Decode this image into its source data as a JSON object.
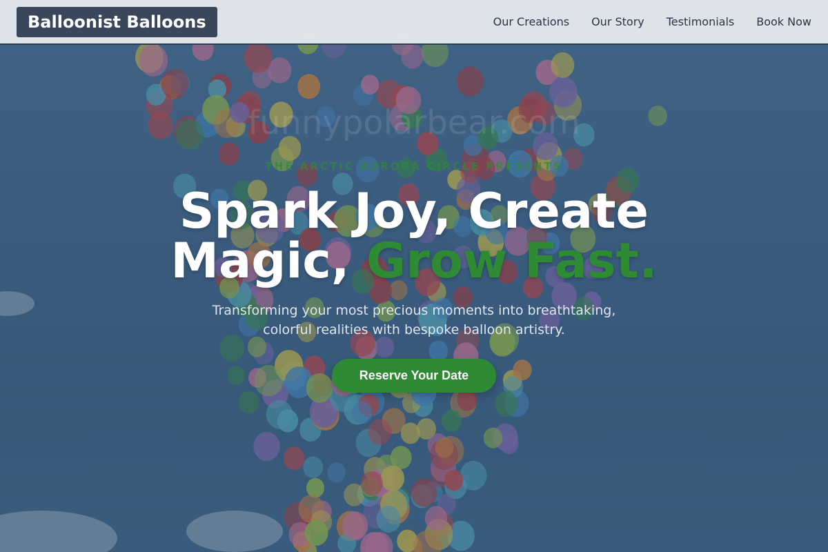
{
  "nav": {
    "brand": "Balloonist Balloons",
    "links": [
      {
        "label": "Our Creations"
      },
      {
        "label": "Our Story"
      },
      {
        "label": "Testimonials"
      },
      {
        "label": "Book Now"
      }
    ]
  },
  "hero": {
    "eyebrow": "THE ARCTIC AURORA CIRCLE PRESENTS",
    "headline_line1": "Spark Joy, Create",
    "headline_line2_plain": "Magic,",
    "headline_line2_accent": "Grow Fast.",
    "watermark": "funnypolarbear.com",
    "subtitle": "Transforming your most precious moments into breathtaking, colorful realities with bespoke balloon artistry.",
    "cta_label": "Reserve Your Date"
  },
  "colors": {
    "accent": "#2e8b34",
    "brand_bg": "#3a4659",
    "nav_bg": "#e6eaee",
    "hero_bg": "#466a8e"
  },
  "background_image": "balloons-in-sky"
}
